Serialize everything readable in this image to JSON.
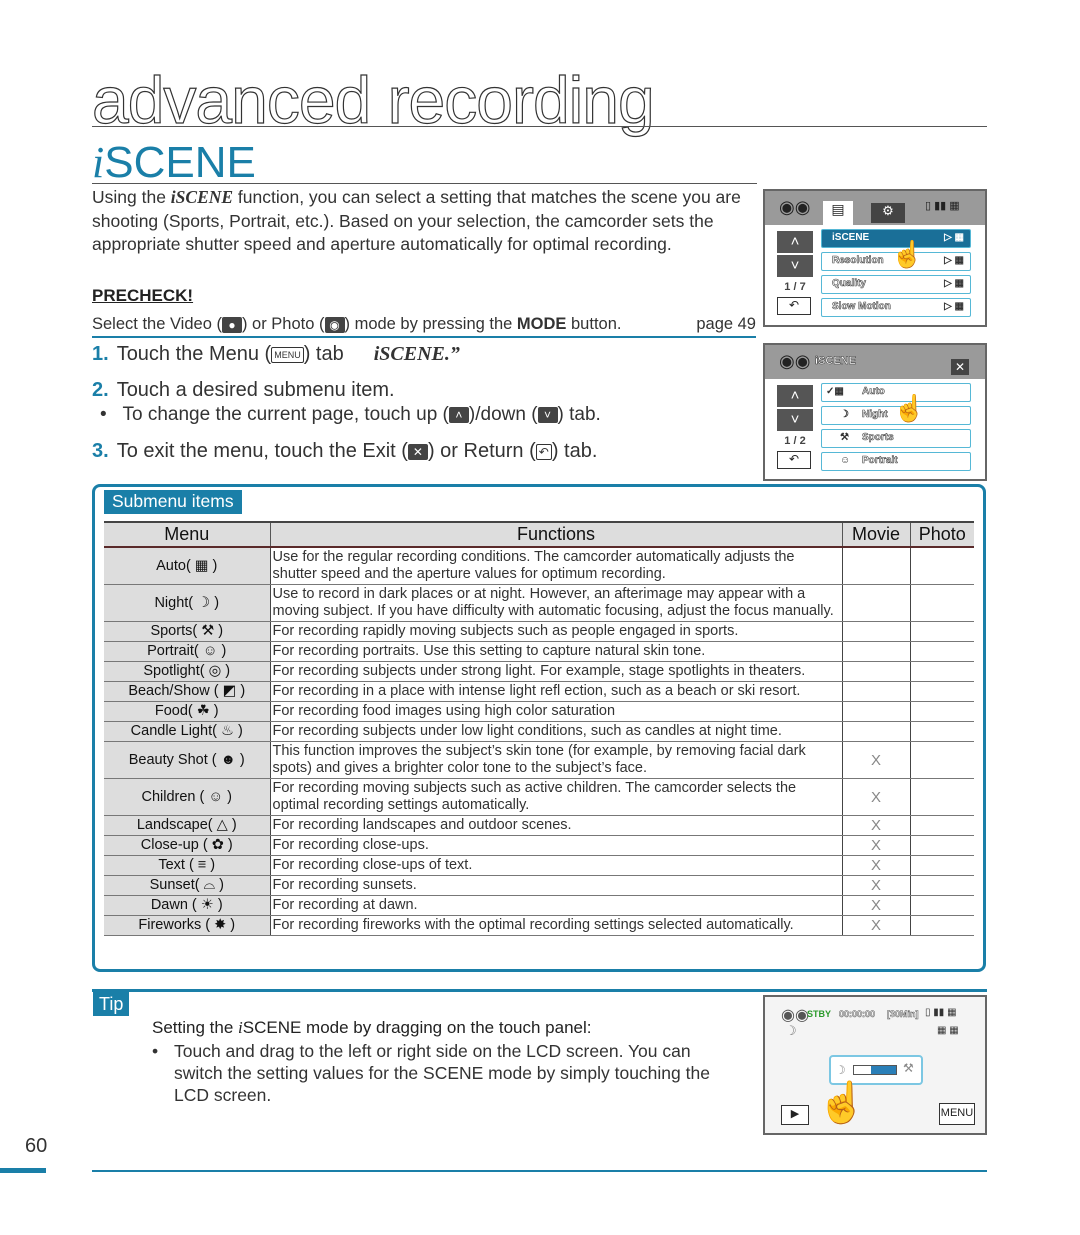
{
  "chapter_title": "advanced recording",
  "section": {
    "title_prefix": "i",
    "title_rest": "SCENE"
  },
  "intro": {
    "before": "Using the ",
    "brand": "iSCENE",
    "after": " function, you can select a setting that matches the scene you are shooting (Sports, Portrait, etc.). Based on your selection, the camcorder sets the appropriate shutter speed and aperture automatically for optimal recording."
  },
  "precheck": {
    "title": "PRECHECK!",
    "t1": "Select the Video (",
    "t2": ") or Photo (",
    "t3": ") mode by pressing the ",
    "mode": "MODE",
    "t4": " button.",
    "page_ref": "page 49"
  },
  "steps": [
    {
      "num": "1.",
      "t1": "Touch the Menu (",
      "icon": "MENU",
      "t2": ") tab",
      "t3": "iSCENE.”"
    },
    {
      "num": "2.",
      "text": "Touch a desired submenu item.",
      "bullet": {
        "t1": "To change the current page, touch up (",
        "t2": ")/down (",
        "t3": ") tab."
      }
    },
    {
      "num": "3.",
      "t1": "To exit the menu, touch the Exit (",
      "t2": ") or Return (",
      "t3": ") tab."
    }
  ],
  "lcd_menu": {
    "page": "1 / 7",
    "items": [
      {
        "label": "iSCENE",
        "selected": true
      },
      {
        "label": "Resolution",
        "selected": false
      },
      {
        "label": "Quality",
        "selected": false
      },
      {
        "label": "Slow Motion",
        "selected": false
      }
    ]
  },
  "lcd_scene": {
    "title": "iSCENE",
    "page": "1 / 2",
    "items": [
      {
        "label": "Auto",
        "checked": true
      },
      {
        "label": "Night",
        "checked": false
      },
      {
        "label": "Sports",
        "checked": false
      },
      {
        "label": "Portrait",
        "checked": false
      }
    ]
  },
  "submenu": {
    "label": "Submenu items",
    "headers": [
      "Menu",
      "Functions",
      "Movie",
      "Photo"
    ],
    "rows": [
      {
        "menu": "Auto( ▦ )",
        "fn": "Use for the regular recording conditions. The camcorder automatically adjusts the shutter speed and the aperture values for optimum recording.",
        "movie": "",
        "photo": ""
      },
      {
        "menu": "Night( ☽ )",
        "fn": "Use to record in dark places or at night. However, an afterimage may appear with a moving subject. If you have difficulty with automatic focusing, adjust the focus manually.",
        "movie": "",
        "photo": ""
      },
      {
        "menu": "Sports( ⚒ )",
        "fn": "For recording rapidly moving subjects such as people engaged in sports.",
        "movie": "",
        "photo": ""
      },
      {
        "menu": "Portrait( ☺ )",
        "fn": "For recording portraits. Use this setting to capture natural skin tone.",
        "movie": "",
        "photo": ""
      },
      {
        "menu": "Spotlight( ◎ )",
        "fn": "For recording subjects under strong light. For example, stage spotlights in theaters.",
        "movie": "",
        "photo": ""
      },
      {
        "menu": "Beach/Show ( ◩ )",
        "fn": "For recording in a place with intense light refl ection, such as a beach or ski resort.",
        "movie": "",
        "photo": ""
      },
      {
        "menu": "Food( ☘ )",
        "fn": "For recording food images using high color saturation",
        "movie": "",
        "photo": ""
      },
      {
        "menu": "Candle Light( ♨ )",
        "fn": "For recording subjects under low light conditions, such as candles at night time.",
        "movie": "",
        "photo": ""
      },
      {
        "menu": "Beauty Shot ( ☻ )",
        "fn": "This function improves the subject’s skin tone (for example, by removing facial dark spots) and gives a brighter color tone to the subject’s face.",
        "movie": "X",
        "photo": ""
      },
      {
        "menu": "Children ( ☺ )",
        "fn": "For recording moving subjects such as active children. The camcorder selects the optimal recording settings automatically.",
        "movie": "X",
        "photo": ""
      },
      {
        "menu": "Landscape( △ )",
        "fn": "For recording landscapes and outdoor scenes.",
        "movie": "X",
        "photo": ""
      },
      {
        "menu": "Close-up ( ✿ )",
        "fn": "For recording close-ups.",
        "movie": "X",
        "photo": ""
      },
      {
        "menu": "Text ( ≡ )",
        "fn": "For recording close-ups of text.",
        "movie": "X",
        "photo": ""
      },
      {
        "menu": "Sunset( ⌓ )",
        "fn": "For recording sunsets.",
        "movie": "X",
        "photo": ""
      },
      {
        "menu": "Dawn ( ☀ )",
        "fn": "For recording at dawn.",
        "movie": "X",
        "photo": ""
      },
      {
        "menu": "Fireworks ( ✸ )",
        "fn": "For recording fireworks with the optimal recording settings selected automatically.",
        "movie": "X",
        "photo": ""
      }
    ]
  },
  "tip": {
    "label": "Tip",
    "heading_before": "Setting the ",
    "heading_brand": "i",
    "heading_after": "SCENE mode by dragging on the touch panel:",
    "bullet": "Touch and drag to the left or right side on the LCD screen. You can switch the setting values for the SCENE mode by simply touching the LCD screen."
  },
  "lcd_live": {
    "status": "STBY",
    "timecode": "00:00:00",
    "remaining": "[30Min]",
    "menu_button": "MENU"
  },
  "page_number": "60",
  "colors": {
    "accent": "#1a7fa8",
    "stby_green": "#2a9a2a"
  }
}
